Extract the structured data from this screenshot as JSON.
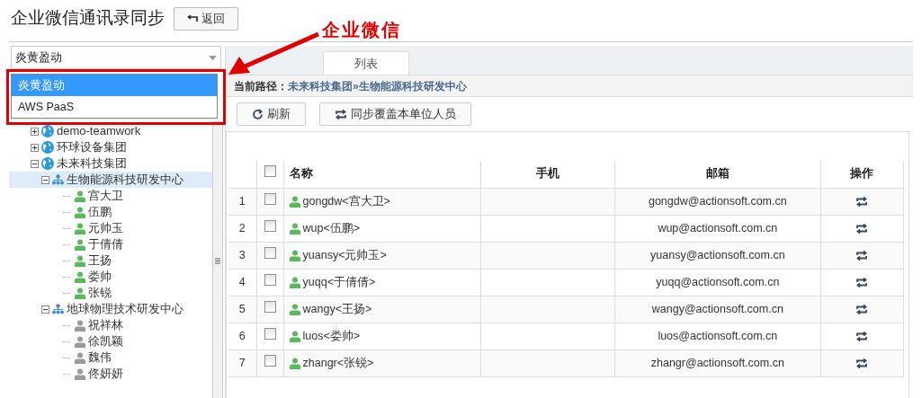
{
  "title": "企业微信通讯录同步",
  "back_button": {
    "label": "返回"
  },
  "annotation": {
    "label": "企业微信"
  },
  "account_select": {
    "value": "炎黄盈动",
    "options": [
      {
        "label": "炎黄盈动",
        "selected": true
      },
      {
        "label": "AWS PaaS",
        "selected": false
      }
    ]
  },
  "tree": [
    {
      "kind": "company",
      "label": "demo-teamwork",
      "expanded": false,
      "selected": false
    },
    {
      "kind": "company",
      "label": "环球设备集团",
      "expanded": false,
      "selected": false
    },
    {
      "kind": "company",
      "label": "未来科技集团",
      "expanded": true,
      "selected": false,
      "children": [
        {
          "kind": "dept",
          "label": "生物能源科技研发中心",
          "expanded": true,
          "selected": true,
          "children": [
            {
              "kind": "user",
              "label": "宫大卫",
              "active": true,
              "selected": false
            },
            {
              "kind": "user",
              "label": "伍鹏",
              "active": true,
              "selected": false
            },
            {
              "kind": "user",
              "label": "元帅玉",
              "active": true,
              "selected": false
            },
            {
              "kind": "user",
              "label": "于倩倩",
              "active": true,
              "selected": false
            },
            {
              "kind": "user",
              "label": "王扬",
              "active": true,
              "selected": false
            },
            {
              "kind": "user",
              "label": "娄帅",
              "active": true,
              "selected": false
            },
            {
              "kind": "user",
              "label": "张锐",
              "active": true,
              "selected": false
            }
          ]
        },
        {
          "kind": "dept",
          "label": "地球物理技术研发中心",
          "expanded": true,
          "selected": false,
          "children": [
            {
              "kind": "user",
              "label": "祝祥林",
              "active": false,
              "selected": false
            },
            {
              "kind": "user",
              "label": "徐凯颖",
              "active": false,
              "selected": false
            },
            {
              "kind": "user",
              "label": "魏伟",
              "active": false,
              "selected": false
            },
            {
              "kind": "user",
              "label": "佟妍妍",
              "active": false,
              "selected": false
            }
          ]
        }
      ]
    }
  ],
  "tabs": [
    {
      "label": "列表",
      "selected": true
    }
  ],
  "path": {
    "label": "当前路径：",
    "value": "未来科技集团»生物能源科技研发中心"
  },
  "toolbar": [
    {
      "kind": "refresh",
      "label": "刷新"
    },
    {
      "kind": "sync",
      "label": "同步覆盖本单位人员"
    }
  ],
  "table": {
    "header_checked": false,
    "columns": [
      "名称",
      "手机",
      "邮箱",
      "操作"
    ],
    "rows": [
      {
        "index": "1",
        "checked": false,
        "name": "gongdw<宫大卫>",
        "email": "gongdw@actionsoft.com.cn"
      },
      {
        "index": "2",
        "checked": false,
        "name": "wup<伍鹏>",
        "email": "wup@actionsoft.com.cn"
      },
      {
        "index": "3",
        "checked": false,
        "name": "yuansy<元帅玉>",
        "email": "yuansy@actionsoft.com.cn"
      },
      {
        "index": "4",
        "checked": false,
        "name": "yuqq<于倩倩>",
        "email": "yuqq@actionsoft.com.cn"
      },
      {
        "index": "5",
        "checked": false,
        "name": "wangy<王扬>",
        "email": "wangy@actionsoft.com.cn"
      },
      {
        "index": "6",
        "checked": false,
        "name": "luos<娄帅>",
        "email": "luos@actionsoft.com.cn"
      },
      {
        "index": "7",
        "checked": false,
        "name": "zhangr<张锐>",
        "email": "zhangr@actionsoft.com.cn"
      }
    ]
  }
}
